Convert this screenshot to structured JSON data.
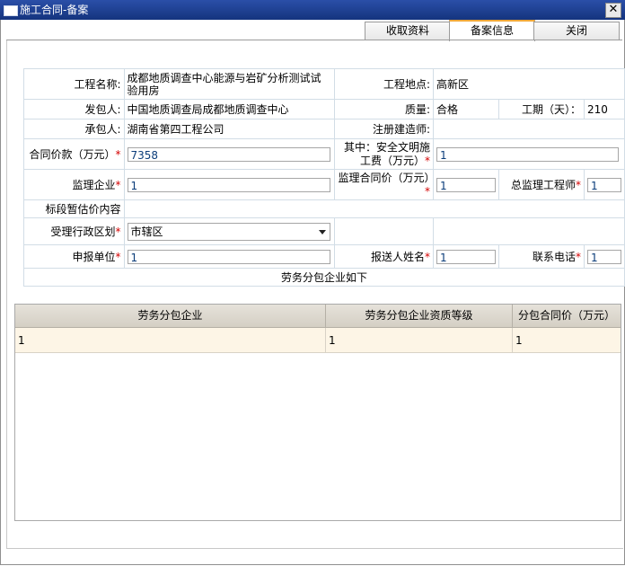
{
  "window": {
    "title": "施工合同-备案",
    "close": "✕"
  },
  "tabs": [
    {
      "label": "收取资料"
    },
    {
      "label": "备案信息"
    },
    {
      "label": "关闭"
    }
  ],
  "form": {
    "project_name_label": "工程名称:",
    "project_name_value": "成都地质调查中心能源与岩矿分析测试试验用房",
    "location_label": "工程地点:",
    "location_value": "高新区",
    "client_label": "发包人:",
    "client_value": "中国地质调查局成都地质调查中心",
    "quality_label": "质量:",
    "quality_value": "合格",
    "duration_label": "工期（天）：",
    "duration_value": "210",
    "contractor_label": "承包人:",
    "contractor_value": "湖南省第四工程公司",
    "architect_label": "注册建造师:",
    "architect_value": "",
    "price_label": "合同价款（万元）",
    "price_value": "7358",
    "safety_label": "其中：安全文明施工费（万元）",
    "safety_value": "1",
    "supervisor_label": "监理企业",
    "supervisor_value": "1",
    "supervision_price_label": "监理合同价（万元）",
    "supervision_price_value": "1",
    "chief_engineer_label": "总监理工程师",
    "chief_engineer_value": "1",
    "provisional_label": "标段暂估价内容",
    "provisional_value": "",
    "district_label": "受理行政区划",
    "district_value": "市辖区",
    "applicant_label": "申报单位",
    "applicant_value": "1",
    "sender_label": "报送人姓名",
    "sender_value": "1",
    "phone_label": "联系电话",
    "phone_value": "1",
    "subcontract_caption": "劳务分包企业如下",
    "required_mark": "*"
  },
  "grid": {
    "columns": [
      "劳务分包企业",
      "劳务分包企业资质等级",
      "分包合同价（万元）"
    ],
    "rows": [
      [
        "1",
        "1",
        "1"
      ]
    ]
  }
}
